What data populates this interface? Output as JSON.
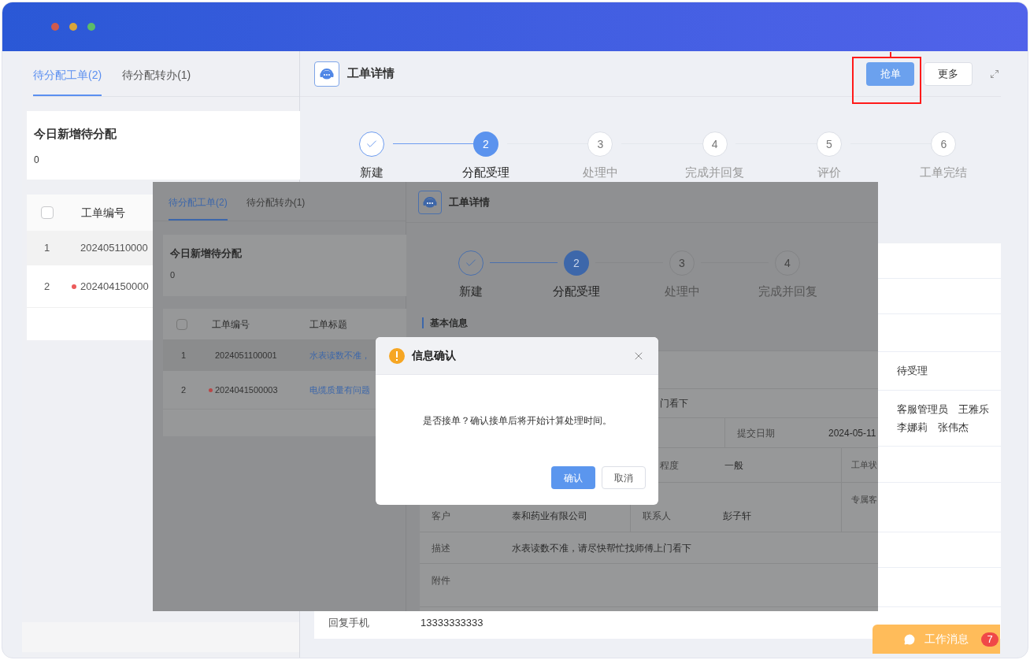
{
  "left_panel": {
    "tabs": [
      {
        "label": "待分配工单(2)",
        "selected": true
      },
      {
        "label": "待分配转办(1)",
        "selected": false
      }
    ],
    "stat_card": {
      "title": "今日新增待分配",
      "value": "0"
    },
    "table": {
      "select_all": {
        "checked": false
      },
      "columns": [
        "工单编号"
      ],
      "rows": [
        {
          "index": "1",
          "code": "202405110000",
          "selected": true,
          "unread": false
        },
        {
          "index": "2",
          "code": "202404150000",
          "selected": false,
          "unread": true
        }
      ]
    }
  },
  "detail": {
    "title": "工单详情",
    "actions": [
      {
        "label": "抢单",
        "kind": "primary"
      },
      {
        "label": "更多",
        "kind": "default"
      }
    ],
    "steps": [
      {
        "label": "新建",
        "kind": "done"
      },
      {
        "number": "2",
        "label": "分配受理",
        "kind": "active"
      },
      {
        "number": "3",
        "label": "处理中",
        "kind": "pending"
      },
      {
        "number": "4",
        "label": "完成并回复",
        "kind": "pending"
      },
      {
        "number": "5",
        "label": "评价",
        "kind": "pending"
      },
      {
        "number": "6",
        "label": "工单完结",
        "kind": "pending"
      }
    ],
    "status_value": "待受理",
    "assignees": [
      "客服管理员",
      "王雅乐",
      "李娜莉",
      "张伟杰"
    ],
    "reply_phone": {
      "label": "回复手机",
      "value": "13333333333"
    }
  },
  "inset": {
    "tabs": [
      {
        "label": "待分配工单(2)",
        "selected": true
      },
      {
        "label": "待分配转办(1)",
        "selected": false
      }
    ],
    "stat_card": {
      "title": "今日新增待分配",
      "value": "0"
    },
    "table": {
      "select_all": {
        "checked": false
      },
      "columns": [
        "工单编号",
        "工单标题"
      ],
      "rows": [
        {
          "index": "1",
          "code": "2024051100001",
          "title": "水表读数不准，",
          "selected": true,
          "unread": false
        },
        {
          "index": "2",
          "code": "2024041500003",
          "title": "电缆质量有问题",
          "selected": false,
          "unread": true
        }
      ]
    },
    "detail_title": "工单详情",
    "steps": [
      {
        "label": "新建",
        "kind": "done"
      },
      {
        "number": "2",
        "label": "分配受理",
        "kind": "active"
      },
      {
        "number": "3",
        "label": "处理中",
        "kind": "pending"
      },
      {
        "number": "4",
        "label": "完成并回复",
        "kind": "pending"
      }
    ],
    "section_title": "基本信息",
    "description_tail": "门看下",
    "submit_date": {
      "label": "提交日期",
      "value": "2024-05-11"
    },
    "urgency": {
      "label": "程度",
      "value": "一般"
    },
    "status_label": "工单状",
    "customer": {
      "label": "客户",
      "value": "泰和药业有限公司"
    },
    "contact": {
      "label": "联系人",
      "value": "彭子轩"
    },
    "owner_label": "专属客",
    "description": {
      "label": "描述",
      "value": "水表读数不准，请尽快帮忙找师傅上门看下"
    },
    "attachment_label": "附件",
    "dialog": {
      "title": "信息确认",
      "message": "是否接单？确认接单后将开始计算处理时间。",
      "buttons": [
        {
          "label": "确认",
          "kind": "primary"
        },
        {
          "label": "取消",
          "kind": "default"
        }
      ]
    }
  },
  "work_message": {
    "label": "工作消息",
    "count": "7"
  }
}
